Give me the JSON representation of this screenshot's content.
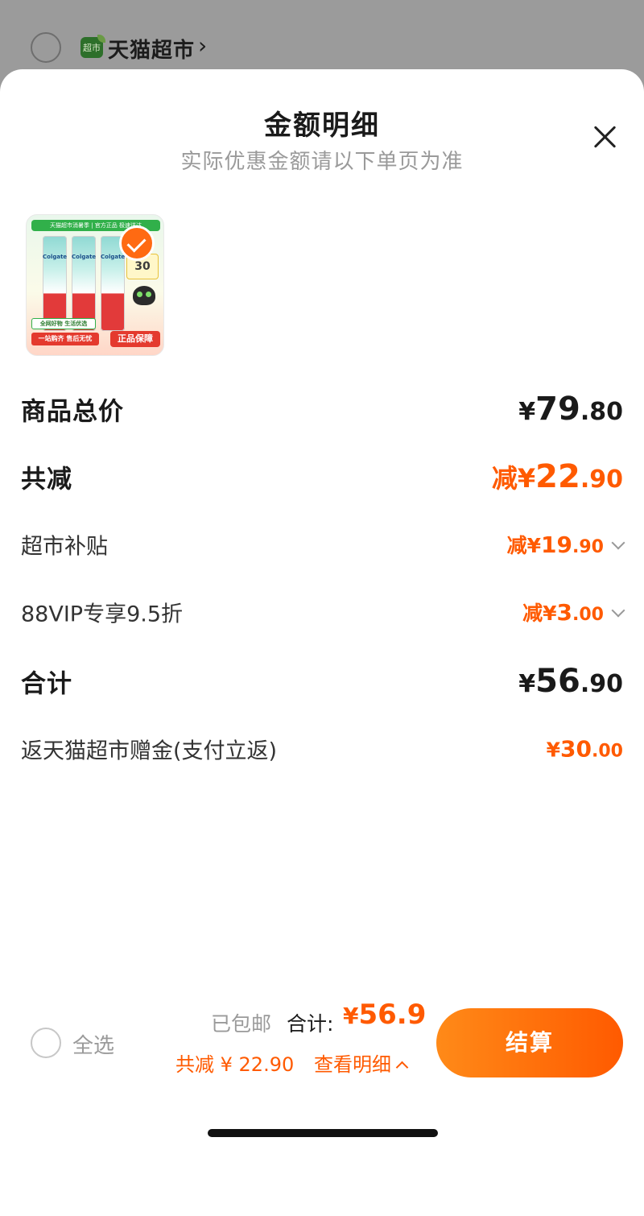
{
  "store": {
    "logo_text": "超市",
    "name": "天猫超市",
    "chevron": "›"
  },
  "sheet": {
    "title": "金额明细",
    "subtitle": "实际优惠金额请以下单页为准",
    "close_icon": "close-icon"
  },
  "product": {
    "banner": "天猫超市消暑季 | 官方正品 极速送达",
    "brand": "Colgate",
    "promo": "30",
    "foot1": "全网好物 生活优选",
    "foot2": "一站购齐 售后无忧",
    "foot3": "正品保障",
    "selected": true
  },
  "rows": {
    "subtotal": {
      "label": "商品总价",
      "prefix": "¥",
      "int": "79",
      "dec": ".80"
    },
    "reduction": {
      "label": "共减",
      "prefix": "减¥",
      "int": "22",
      "dec": ".90"
    },
    "subsidy": {
      "label": "超市补贴",
      "prefix": "减¥",
      "int": "19",
      "dec": ".90"
    },
    "vip": {
      "label": "88VIP专享9.5折",
      "prefix": "减¥",
      "int": "3",
      "dec": ".00"
    },
    "total": {
      "label": "合计",
      "prefix": "¥",
      "int": "56",
      "dec": ".90"
    },
    "cashback": {
      "label": "返天猫超市赠金(支付立返)",
      "prefix": "¥",
      "int": "30",
      "dec": ".00"
    }
  },
  "bottom": {
    "select_all": "全选",
    "shipping": "已包邮",
    "total_label": "合计:",
    "total_prefix": "¥",
    "total_value": "56.9",
    "discount": "共减 ¥ 22.90",
    "detail_link": "查看明细",
    "checkout": "结算"
  },
  "colors": {
    "accent": "#ff5a00",
    "checkout_start": "#ff8a18",
    "checkout_end": "#ff5a00"
  }
}
